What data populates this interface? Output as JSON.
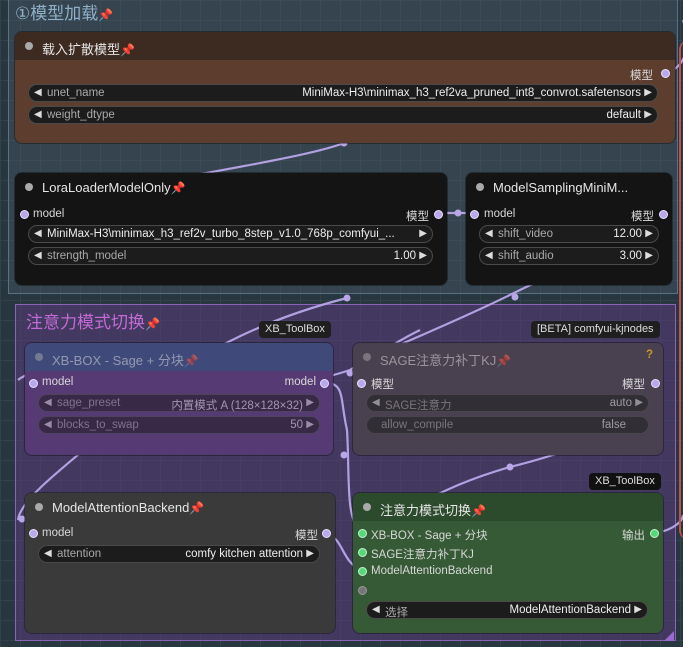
{
  "top_group": {
    "title": "①模型加载"
  },
  "attention_group": {
    "title": "注意力模式切换"
  },
  "pin_glyph": "📌",
  "nodes": {
    "diffusion_loader": {
      "title": "载入扩散模型",
      "output_label": "模型",
      "widgets": [
        {
          "label": "unet_name",
          "value": "MiniMax-H3\\minimax_h3_ref2va_pruned_int8_convrot.safetensors"
        },
        {
          "label": "weight_dtype",
          "value": "default"
        }
      ]
    },
    "lora_loader": {
      "title": "LoraLoaderModelOnly",
      "input_label": "model",
      "output_label": "模型",
      "widgets": [
        {
          "label": "",
          "value": "MiniMax-H3\\minimax_h3_ref2v_turbo_8step_v1.0_768p_comfyui_..."
        },
        {
          "label": "strength_model",
          "value": "1.00"
        }
      ]
    },
    "model_sampling": {
      "title": "ModelSamplingMiniM...",
      "input_label": "model",
      "output_label": "模型",
      "widgets": [
        {
          "label": "shift_video",
          "value": "12.00"
        },
        {
          "label": "shift_audio",
          "value": "3.00"
        }
      ]
    },
    "xb_box": {
      "badge": "XB_ToolBox",
      "title": "XB-BOX - Sage + 分块",
      "input_label": "model",
      "output_label": "model",
      "widgets": [
        {
          "label": "sage_preset",
          "value": "内置模式 A (128×128×32)"
        },
        {
          "label": "blocks_to_swap",
          "value": "50"
        }
      ]
    },
    "sage_patch": {
      "badge": "[BETA] comfyui-kjnodes",
      "title": "SAGE注意力补丁KJ",
      "help": "?",
      "input_label": "模型",
      "output_label": "模型",
      "widgets": [
        {
          "label": "SAGE注意力",
          "value": "auto"
        },
        {
          "label": "allow_compile",
          "value": "false"
        }
      ]
    },
    "attention_backend": {
      "title": "ModelAttentionBackend",
      "input_label": "model",
      "output_label": "模型",
      "widgets": [
        {
          "label": "attention",
          "value": "comfy kitchen attention"
        }
      ]
    },
    "attention_switch": {
      "badge": "XB_ToolBox",
      "title": "注意力模式切换",
      "output_label": "输出",
      "inputs": [
        "XB-BOX - Sage + 分块",
        "SAGE注意力补丁KJ",
        "ModelAttentionBackend"
      ],
      "widgets": [
        {
          "label": "选择",
          "value": "ModelAttentionBackend"
        }
      ]
    }
  },
  "colors": {
    "loader_body": "#5c3d2e",
    "loader_head": "#3d2a21",
    "node_body": "#141414",
    "group_purple": "#5a3d7a",
    "switch_body": "#355a35",
    "link": "#b8a6e8"
  }
}
